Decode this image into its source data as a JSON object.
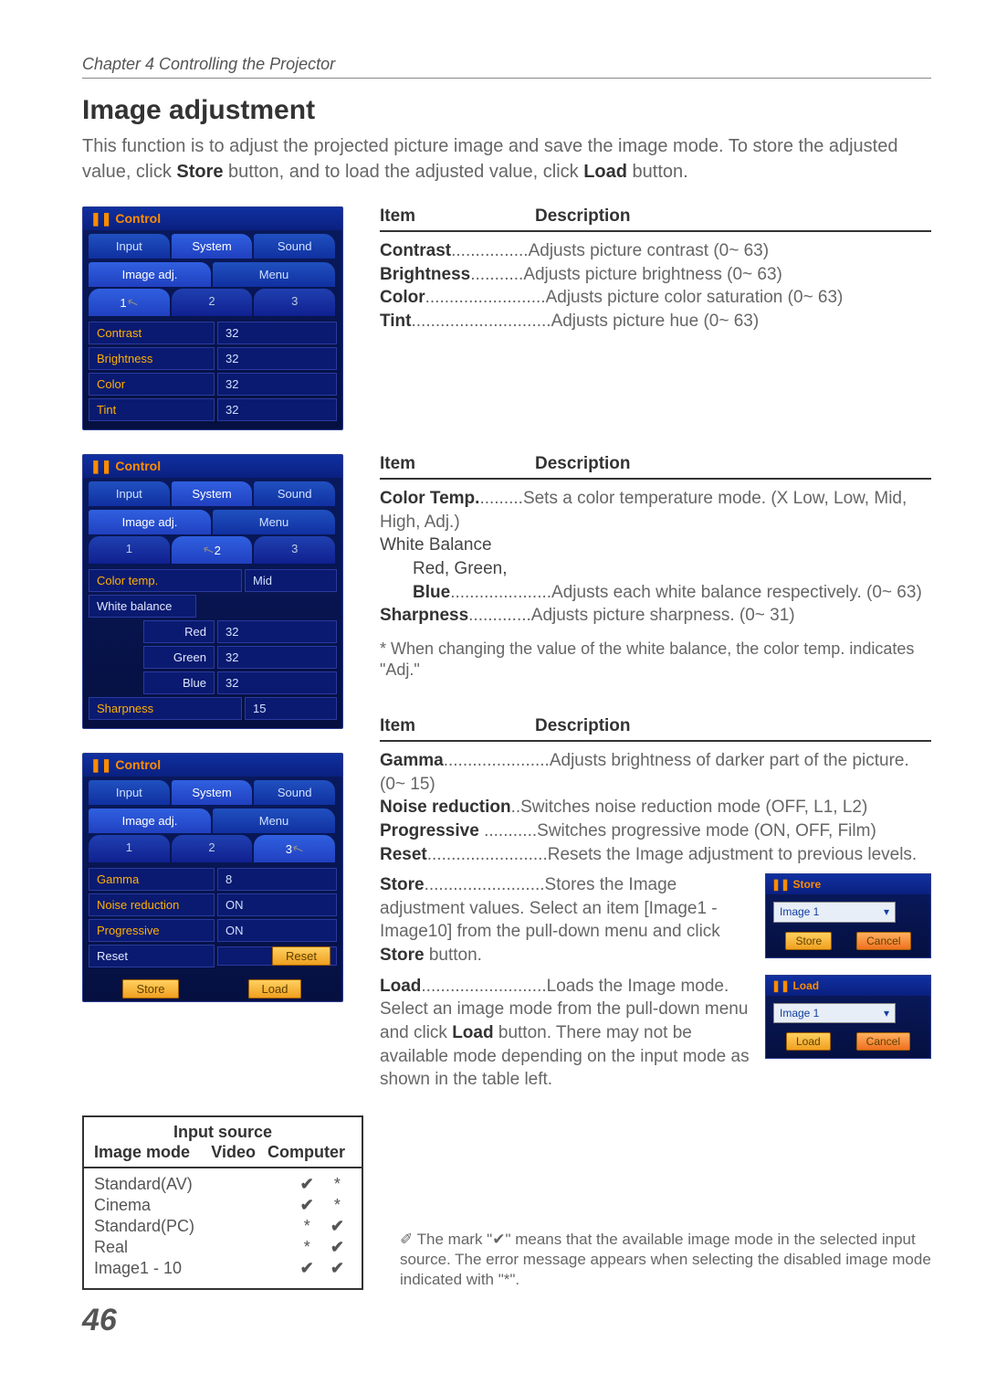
{
  "chapter": "Chapter 4 Controlling the Projector",
  "title": "Image adjustment",
  "intro_a": "This function is to adjust the projected picture image and save the image mode. To store the adjusted value, click ",
  "intro_b": "Store",
  "intro_c": " button, and to load the adjusted value, click ",
  "intro_d": "Load",
  "intro_e": " button.",
  "hdr_item": "Item",
  "hdr_desc": "Description",
  "panel": {
    "title": "Control",
    "tabs": {
      "input": "Input",
      "system": "System",
      "sound": "Sound"
    },
    "sub": {
      "imageadj": "Image adj.",
      "menu": "Menu"
    },
    "pages": {
      "p1": "1",
      "p2": "2",
      "p3": "3"
    }
  },
  "p1": {
    "rows": [
      {
        "l": "Contrast",
        "v": "32"
      },
      {
        "l": "Brightness",
        "v": "32"
      },
      {
        "l": "Color",
        "v": "32"
      },
      {
        "l": "Tint",
        "v": "32"
      }
    ]
  },
  "p2": {
    "colortemp": {
      "l": "Color temp.",
      "v": "Mid"
    },
    "wb": {
      "l": "White balance",
      "r": "Red",
      "g": "Green",
      "b": "Blue",
      "rv": "32",
      "gv": "32",
      "bv": "32"
    },
    "sharp": {
      "l": "Sharpness",
      "v": "15"
    }
  },
  "p3": {
    "gamma": {
      "l": "Gamma",
      "v": "8"
    },
    "nr": {
      "l": "Noise reduction",
      "v": "ON"
    },
    "prog": {
      "l": "Progressive",
      "v": "ON"
    },
    "reset": {
      "l": "Reset",
      "btn": "Reset"
    },
    "store": "Store",
    "load": "Load"
  },
  "desc1": [
    {
      "t": "Contrast",
      "d": "................Adjusts picture contrast (0~ 63)"
    },
    {
      "t": "Brightness",
      "d": "...........Adjusts picture brightness (0~ 63)"
    },
    {
      "t": "Color",
      "d": ".........................Adjusts picture color saturation (0~ 63)"
    },
    {
      "t": "Tint",
      "d": ".............................Adjusts picture hue (0~ 63)"
    }
  ],
  "desc2": {
    "ct_t": "Color Temp.",
    "ct_d": ".........Sets a color temperature mode. (X Low, Low, Mid, High, Adj.)",
    "wb_h": "White Balance",
    "wb_sub": "Red, Green,",
    "wb_t": "Blue",
    "wb_d": ".....................Adjusts each white balance respectively. (0~ 63)",
    "sh_t": "Sharpness",
    "sh_d": ".............Adjusts picture sharpness. (0~ 31)",
    "note": "* When changing the value of the white balance, the color temp. indicates \"Adj.\""
  },
  "desc3": {
    "gm_t": "Gamma",
    "gm_d": "......................Adjusts brightness of darker part of the picture. (0~ 15)",
    "nr_t": "Noise reduction",
    "nr_d": "..Switches noise reduction mode (OFF, L1, L2)",
    "pr_t": "Progressive ",
    "pr_d": "...........Switches progressive mode (ON, OFF, Film)",
    "rs_t": "Reset",
    "rs_d": ".........................Resets the Image adjustment to previous levels.",
    "st_t": "Store",
    "st_d": ".........................Stores the Image adjustment values. Select an item [Image1 - Image10] from the pull-down menu and click ",
    "st_b": "Store",
    "st_e": " button.",
    "ld_t": "Load",
    "ld_d": "..........................Loads the Image mode. Select an image mode from the pull-down menu and click ",
    "ld_b": "Load",
    "ld_e": " button. There may not be available mode depending on the input mode as shown in the table left."
  },
  "tiny": {
    "store": "Store",
    "load": "Load",
    "img": "Image 1",
    "btn_store": "Store",
    "btn_load": "Load",
    "btn_cancel": "Cancel"
  },
  "src": {
    "hdr": "Input source",
    "c0": "Image mode",
    "c1": "Video",
    "c2": "Computer",
    "rows": [
      {
        "m": "Standard(AV)",
        "v": "✔",
        "c": "*"
      },
      {
        "m": "Cinema",
        "v": "✔",
        "c": "*"
      },
      {
        "m": "Standard(PC)",
        "v": "*",
        "c": "✔"
      },
      {
        "m": "Real",
        "v": "*",
        "c": "✔"
      },
      {
        "m": "Image1 - 10",
        "v": "✔",
        "c": "✔"
      }
    ]
  },
  "footnote": "✐ The mark \"✔\" means that the available image mode in the selected input source. The error message appears when selecting the disabled image mode indicated with \"*\".",
  "pagenum": "46"
}
